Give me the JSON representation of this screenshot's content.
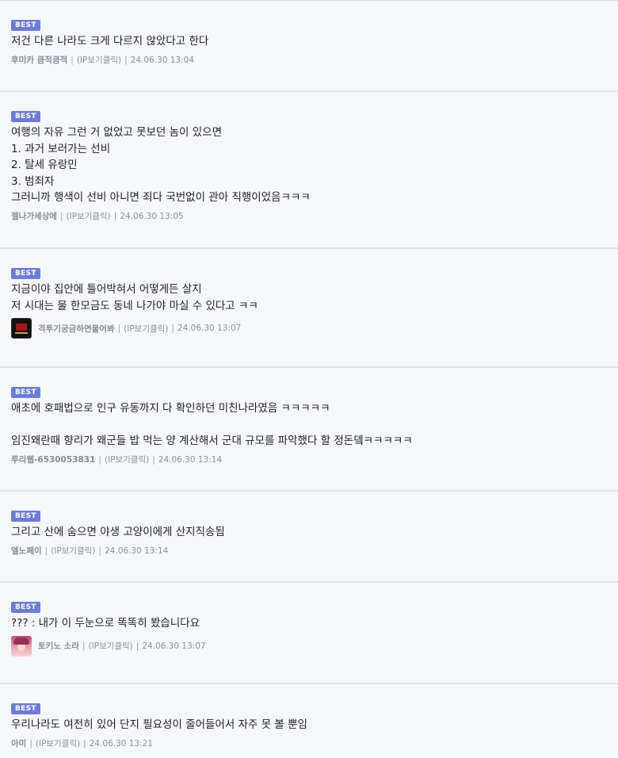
{
  "badge_label": "BEST",
  "meta": {
    "ip_label": "(IP보기클릭)"
  },
  "comments": [
    {
      "text": "저건 다른 나라도 크게 다르지 않았다고 한다",
      "author": "후미카 큼적큼적",
      "timestamp": "24.06.30 13:04"
    },
    {
      "text": "여행의 자유 그런 거 없었고 못보던 놈이 있으면\n1. 과거 보러가는 선비\n2. 탈세 유랑민\n3. 범죄자\n그러니까 행색이 선비 아니면 죄다 국번없이 관아 직행이었음ㅋㅋㅋ",
      "author": "젤나가세상에",
      "timestamp": "24.06.30 13:05"
    },
    {
      "text": "지금이야 집안에 틀어박혀서 어떻게든 살지\n저 시대는 물 한모금도 동네 나가야 마실 수 있다고 ㅋㅋ",
      "author": "격투기궁금하면물어봐",
      "timestamp": "24.06.30 13:07",
      "avatar": "fight-logo-avatar"
    },
    {
      "text": "애초에 호패법으로 인구 유동까지 다 확인하던 미친나라였음 ㅋㅋㅋㅋㅋ\n\n임진왜란때 향리가 왜군들 밥 먹는 양 계산해서 군대 규모를 파악했다 할 정돈뎈ㅋㅋㅋㅋㅋ",
      "author": "루리웹-6530053831",
      "timestamp": "24.06.30 13:14"
    },
    {
      "text": "그리고 산에 숨으면 야생 고양이에게 산지직송됨",
      "author": "엘노페이",
      "timestamp": "24.06.30 13:14"
    },
    {
      "text": "??? : 내가 이 두눈으로 똑똑히 봤습니다요",
      "author": "토키노 소라",
      "timestamp": "24.06.30 13:07",
      "avatar": "anime-girl-avatar"
    },
    {
      "text": "우리나라도 여전히 있어 단지 필요성이 줄어들어서 자주 못 볼 뿐임",
      "author": "아미",
      "timestamp": "24.06.30 13:21"
    }
  ]
}
